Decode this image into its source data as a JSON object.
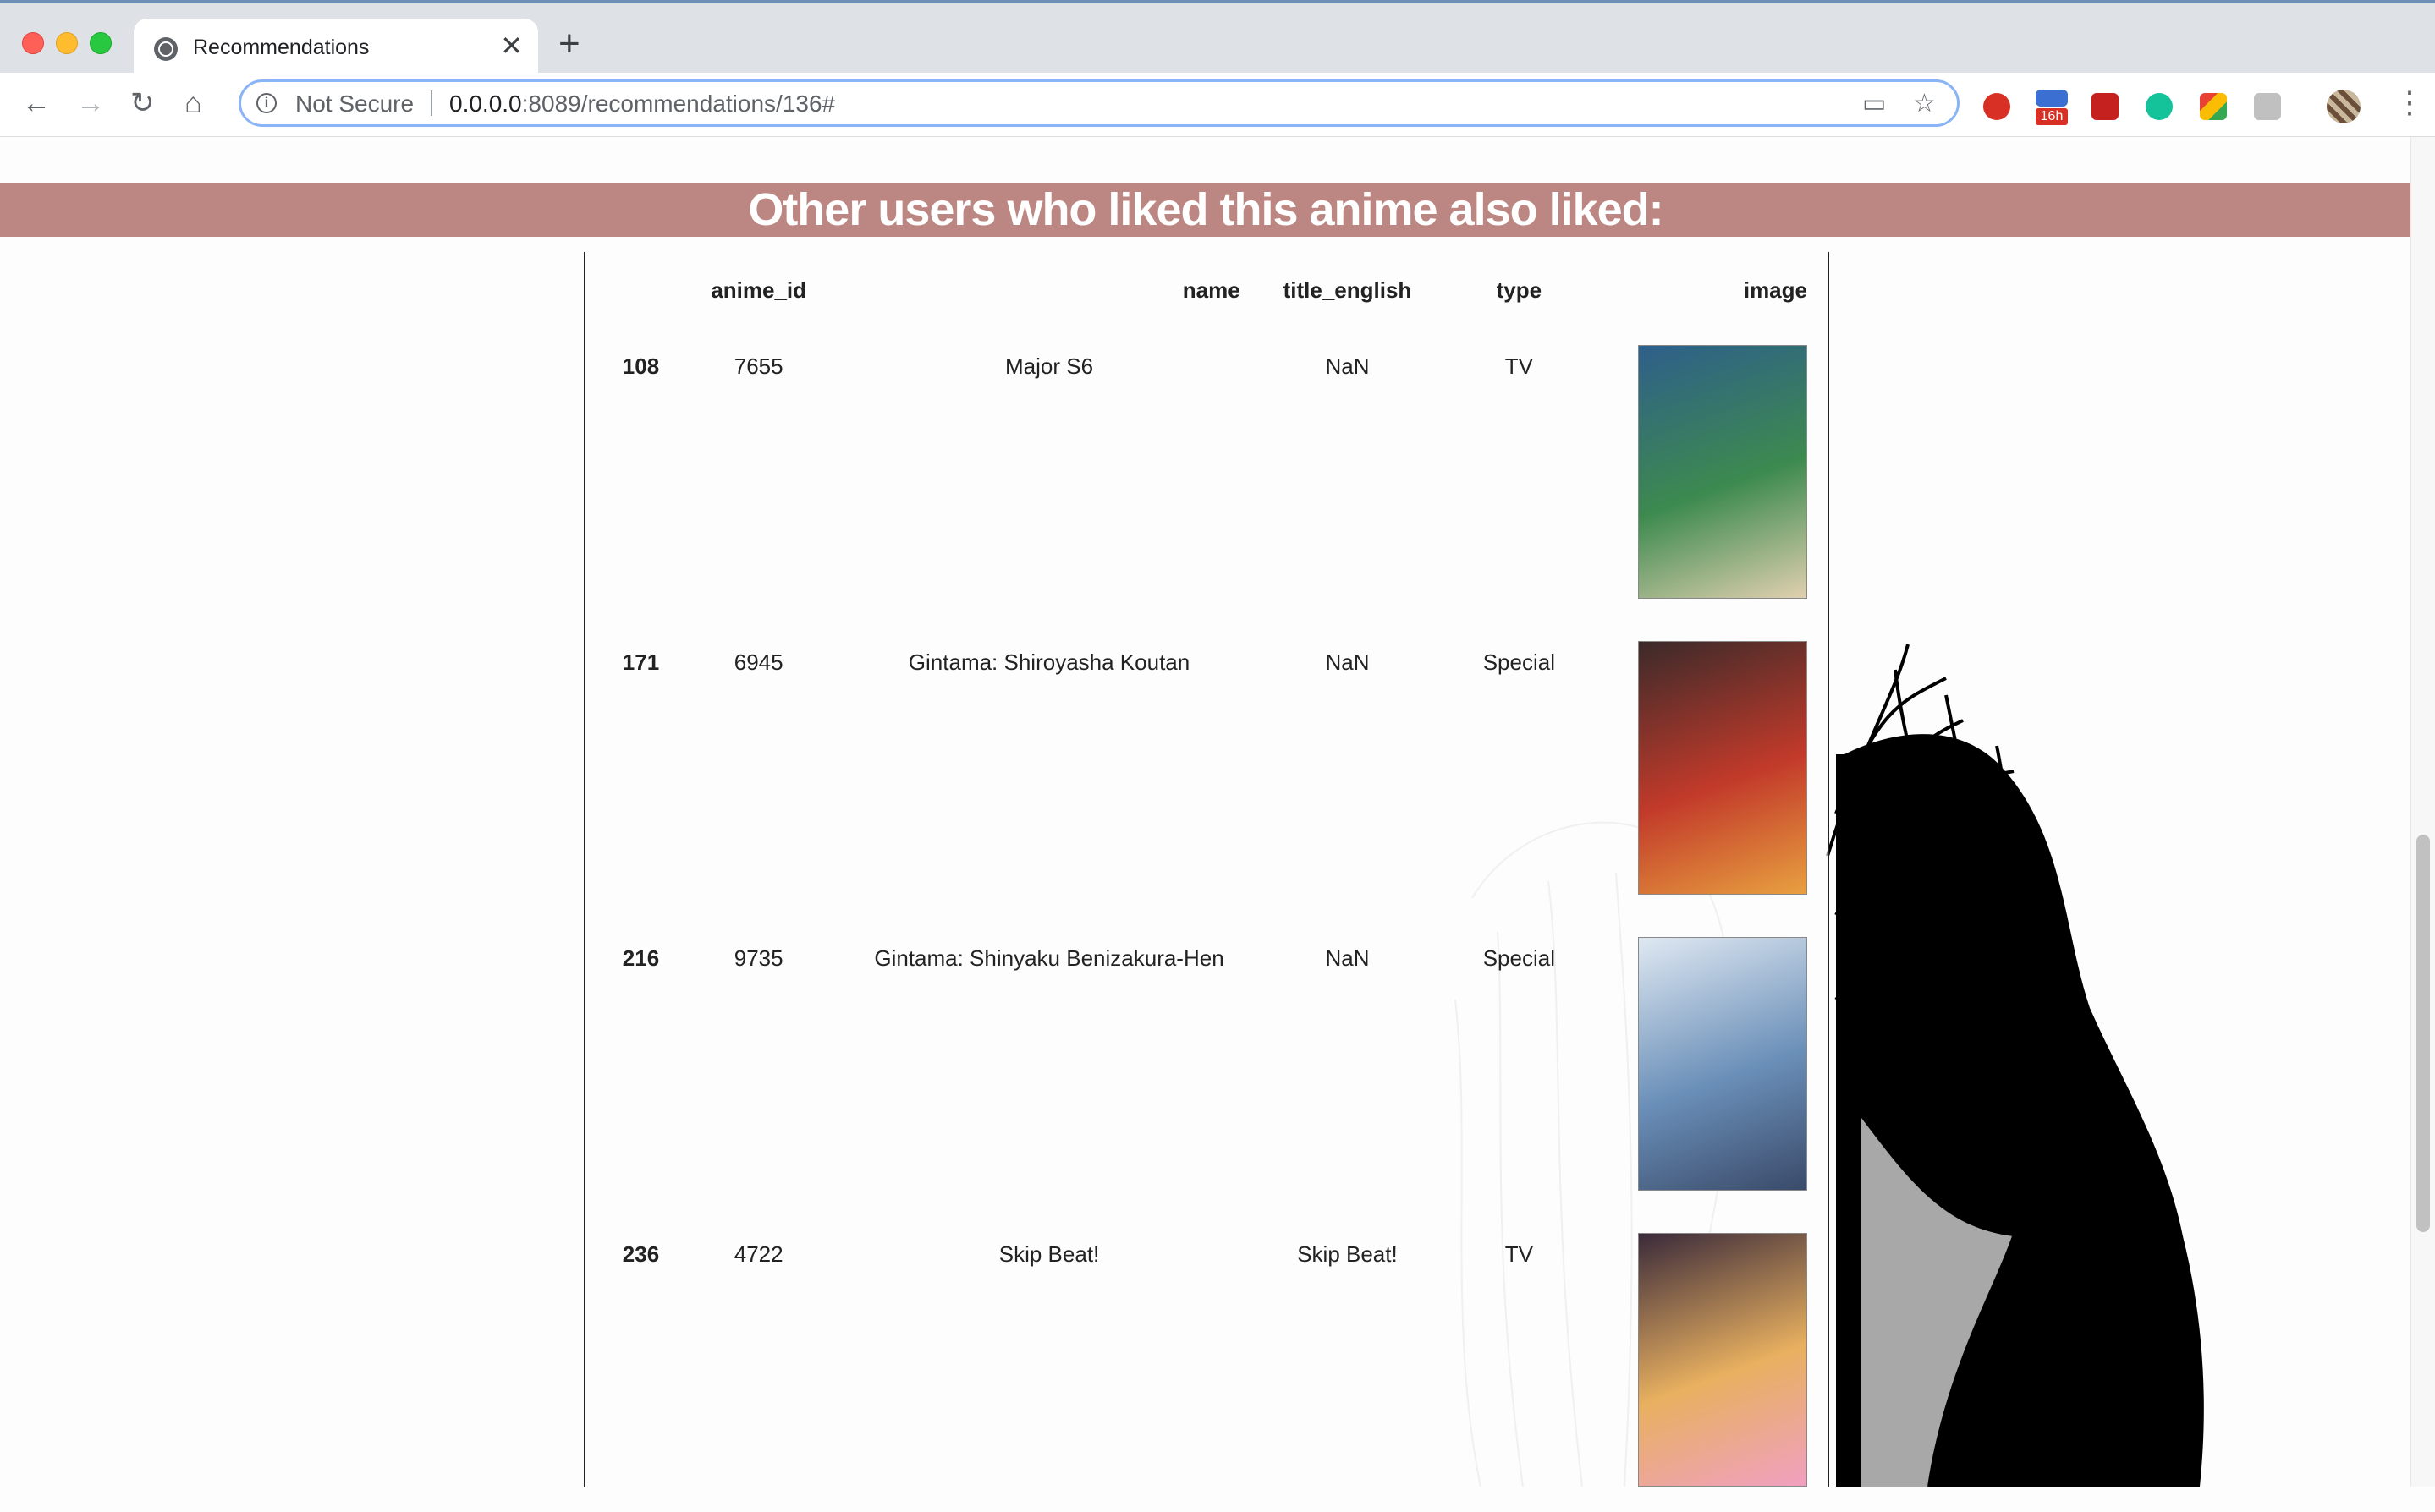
{
  "browser": {
    "tab_title": "Recommendations",
    "security_label": "Not Secure",
    "url_host": "0.0.0.0",
    "url_rest": ":8089/recommendations/136#",
    "extension_badge": "16h"
  },
  "page": {
    "heading": "Other users who liked this anime also liked:",
    "columns": [
      "",
      "anime_id",
      "name",
      "title_english",
      "type",
      "image"
    ],
    "rows": [
      {
        "index": "108",
        "anime_id": "7655",
        "name": "Major S6",
        "title_english": "NaN",
        "type": "TV",
        "poster_colors": [
          "#2e5f8a",
          "#3d8a4f",
          "#e0d0b0"
        ]
      },
      {
        "index": "171",
        "anime_id": "6945",
        "name": "Gintama: Shiroyasha Koutan",
        "title_english": "NaN",
        "type": "Special",
        "poster_colors": [
          "#3b2a2a",
          "#c23a2a",
          "#e8a040"
        ]
      },
      {
        "index": "216",
        "anime_id": "9735",
        "name": "Gintama: Shinyaku Benizakura-Hen",
        "title_english": "NaN",
        "type": "Special",
        "poster_colors": [
          "#dfe8f2",
          "#6a8fb8",
          "#3a4a6a"
        ]
      },
      {
        "index": "236",
        "anime_id": "4722",
        "name": "Skip Beat!",
        "title_english": "Skip Beat!",
        "type": "TV",
        "poster_colors": [
          "#3a2a3a",
          "#e8b060",
          "#f0a0c0"
        ]
      }
    ]
  },
  "colors": {
    "banner": "#bc8782",
    "banner_text": "#ffffff"
  }
}
